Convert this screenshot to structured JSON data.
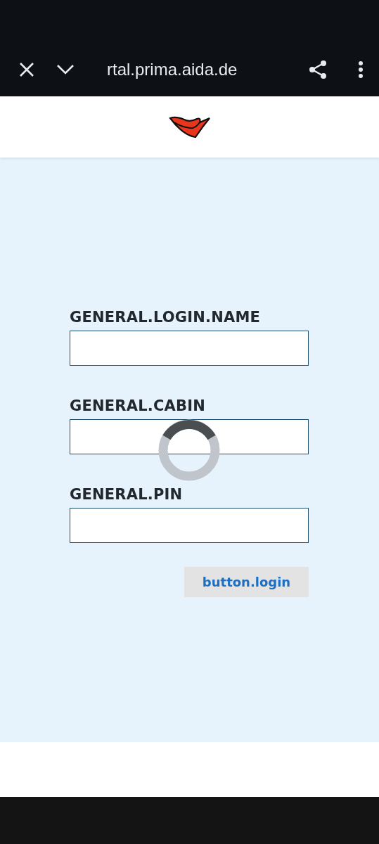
{
  "browser_bar": {
    "url": "rtal.prima.aida.de"
  },
  "form": {
    "fields": [
      {
        "label": "GENERAL.LOGIN.NAME"
      },
      {
        "label": "GENERAL.CABIN"
      },
      {
        "label": "GENERAL.PIN"
      }
    ],
    "button": "button.login"
  }
}
